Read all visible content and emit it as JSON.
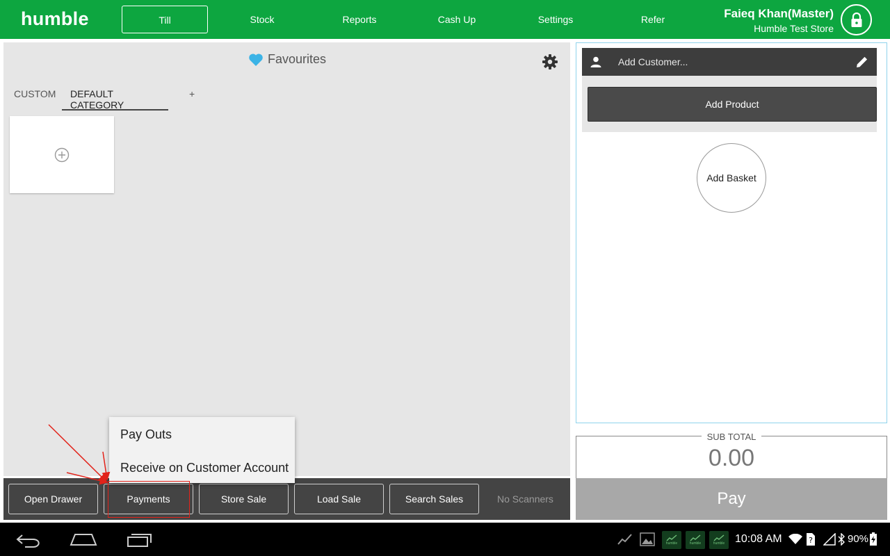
{
  "header": {
    "logo": "humble",
    "tabs": [
      {
        "label": "Till",
        "active": true
      },
      {
        "label": "Stock"
      },
      {
        "label": "Reports"
      },
      {
        "label": "Cash Up"
      },
      {
        "label": "Settings"
      },
      {
        "label": "Refer"
      }
    ],
    "user_name": "Faieq Khan(Master)",
    "store_name": "Humble Test Store",
    "lock_icon": "lock-icon"
  },
  "favourites": {
    "title": "Favourites",
    "heart_icon": "heart-icon",
    "gear_icon": "gear-icon",
    "categories": [
      {
        "label": "CUSTOM"
      },
      {
        "label": "DEFAULT CATEGORY",
        "active": true
      },
      {
        "label": "+"
      }
    ]
  },
  "toolbar": {
    "buttons": [
      "Open Drawer",
      "Payments",
      "Store Sale",
      "Load Sale",
      "Search Sales"
    ],
    "status": "No Scanners"
  },
  "payments_menu": {
    "items": [
      "Pay Outs",
      "Receive on Customer Account"
    ]
  },
  "basket": {
    "customer_placeholder": "Add Customer...",
    "add_product": "Add Product",
    "add_basket": "Add Basket"
  },
  "totals": {
    "subtotal_label": "SUB TOTAL",
    "subtotal_value": "0.00",
    "pay_label": "Pay"
  },
  "system_bar": {
    "time": "10:08 AM",
    "battery": "90%",
    "notification_label": "humble"
  },
  "colors": {
    "brand_green": "#0da640",
    "toolbar_dark": "#444444",
    "annotation_red": "#e2231a",
    "heart_blue": "#3bb3e6"
  }
}
